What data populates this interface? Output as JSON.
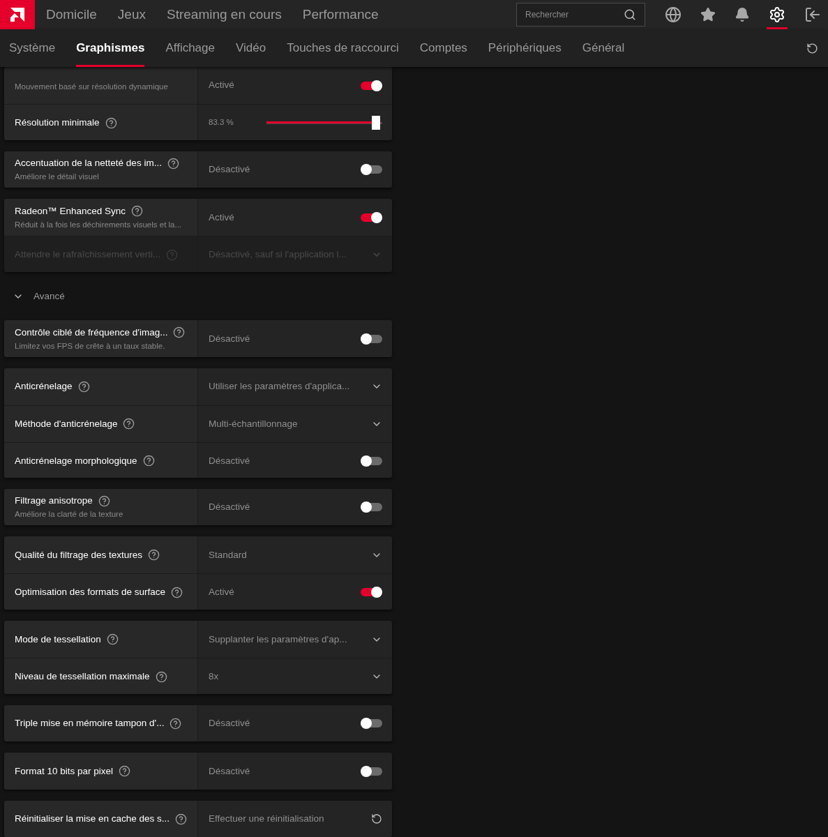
{
  "top_nav": {
    "items": [
      {
        "label": "Domicile",
        "selected": false
      },
      {
        "label": "Jeux",
        "selected": false
      },
      {
        "label": "Streaming en cours",
        "selected": false
      },
      {
        "label": "Performance",
        "selected": false
      }
    ],
    "search": {
      "placeholder": "Rechercher"
    },
    "settings_selected": true
  },
  "tabs": [
    {
      "label": "Système",
      "selected": false
    },
    {
      "label": "Graphismes",
      "selected": true
    },
    {
      "label": "Affichage",
      "selected": false
    },
    {
      "label": "Vidéo",
      "selected": false
    },
    {
      "label": "Touches de raccourci",
      "selected": false
    },
    {
      "label": "Comptes",
      "selected": false
    },
    {
      "label": "Périphériques",
      "selected": false
    },
    {
      "label": "Général",
      "selected": false
    }
  ],
  "cards_top": [
    {
      "rows": [
        {
          "kind": "toggle",
          "sublabel": "Mouvement basé sur résolution dynamique",
          "value": "Activé",
          "on": true,
          "disabled": false
        },
        {
          "kind": "slider",
          "label": "Résolution minimale",
          "value": "83.3 %",
          "level": 0.98,
          "disabled": false
        }
      ]
    },
    {
      "rows": [
        {
          "kind": "toggle",
          "label": "Accentuation de la netteté des im...",
          "sublabel": "Améliore le détail visuel",
          "value": "Désactivé",
          "on": false,
          "disabled": false
        }
      ]
    },
    {
      "rows": [
        {
          "kind": "toggle",
          "label": "Radeon™ Enhanced Sync",
          "sublabel": "Réduit à la fois les déchirements visuels et la...",
          "value": "Activé",
          "on": true,
          "disabled": false
        },
        {
          "kind": "dropdown",
          "label": "Attendre le rafraîchissement verti...",
          "value": "Désactivé, sauf si l'application l...",
          "disabled": true
        }
      ]
    }
  ],
  "section": {
    "label": "Avancé",
    "expanded": true
  },
  "cards_advanced": [
    {
      "rows": [
        {
          "kind": "toggle",
          "label": "Contrôle ciblé de fréquence d'imag...",
          "sublabel": "Limitez vos FPS de crête à un taux stable.",
          "value": "Désactivé",
          "on": false,
          "disabled": false
        }
      ]
    },
    {
      "rows": [
        {
          "kind": "dropdown",
          "label": "Anticrénelage",
          "value": "Utiliser les paramètres d'applica...",
          "disabled": false
        },
        {
          "kind": "dropdown",
          "label": "Méthode d'anticrénelage",
          "value": "Multi-échantillonnage",
          "disabled": false
        },
        {
          "kind": "toggle",
          "label": "Anticrénelage morphologique",
          "value": "Désactivé",
          "on": false,
          "disabled": false
        }
      ]
    },
    {
      "rows": [
        {
          "kind": "toggle",
          "label": "Filtrage anisotrope",
          "sublabel": "Améliore la clarté de la texture",
          "value": "Désactivé",
          "on": false,
          "disabled": false
        }
      ]
    },
    {
      "rows": [
        {
          "kind": "dropdown",
          "label": "Qualité du filtrage des textures",
          "value": "Standard",
          "disabled": false
        },
        {
          "kind": "toggle",
          "label": "Optimisation des formats de surface",
          "value": "Activé",
          "on": true,
          "disabled": false
        }
      ]
    },
    {
      "rows": [
        {
          "kind": "dropdown",
          "label": "Mode de tessellation",
          "value": "Supplanter les paramètres d'ap...",
          "disabled": false
        },
        {
          "kind": "dropdown",
          "label": "Niveau de tessellation maximale",
          "value": "8x",
          "disabled": false
        }
      ]
    },
    {
      "rows": [
        {
          "kind": "toggle",
          "label": "Triple mise en mémoire tampon d'...",
          "value": "Désactivé",
          "on": false,
          "disabled": false
        }
      ]
    },
    {
      "rows": [
        {
          "kind": "toggle",
          "label": "Format 10 bits par pixel",
          "value": "Désactivé",
          "on": false,
          "disabled": false
        }
      ]
    },
    {
      "rows": [
        {
          "kind": "action",
          "label": "Réinitialiser la mise en cache des s...",
          "value": "Effectuer une réinitialisation",
          "disabled": false
        }
      ]
    }
  ]
}
